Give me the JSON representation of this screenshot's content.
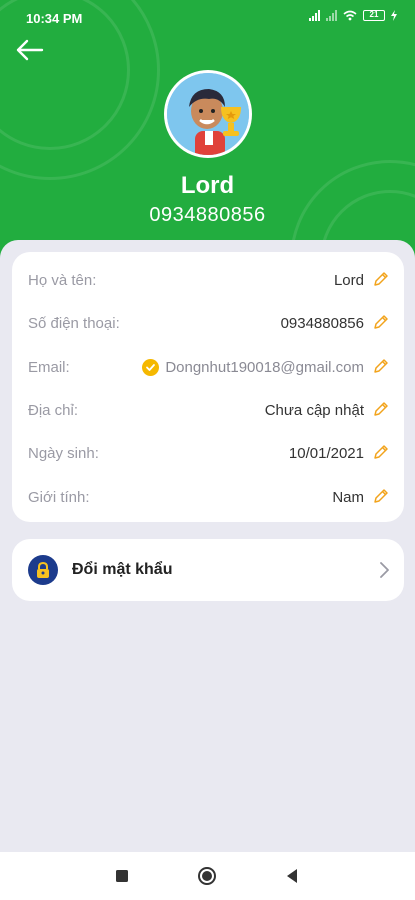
{
  "status_bar": {
    "time": "10:34 PM",
    "battery": "21"
  },
  "profile": {
    "name": "Lord",
    "phone": "0934880856"
  },
  "info": [
    {
      "key": "fullname",
      "label": "Họ và tên:",
      "value": "Lord"
    },
    {
      "key": "phone",
      "label": "Số điện thoại:",
      "value": "0934880856"
    },
    {
      "key": "email",
      "label": "Email:",
      "value": "Dongnhut190018@gmail.com"
    },
    {
      "key": "address",
      "label": "Địa chỉ:",
      "value": "Chưa cập nhật"
    },
    {
      "key": "birthday",
      "label": "Ngày sinh:",
      "value": "10/01/2021"
    },
    {
      "key": "gender",
      "label": "Giới tính:",
      "value": "Nam"
    }
  ],
  "change_password": {
    "label": "Đổi mật khẩu"
  },
  "colors": {
    "header": "#22ad3f",
    "accent_edit": "#f2a31b",
    "verified": "#f5b800",
    "lock": "#1c3b8c",
    "background": "#e9e9f1"
  },
  "icons": [
    "back-arrow-icon",
    "edit-pencil-icon",
    "verified-check-icon",
    "lock-icon",
    "chevron-right-icon",
    "square-icon",
    "circle-icon",
    "triangle-back-icon"
  ]
}
